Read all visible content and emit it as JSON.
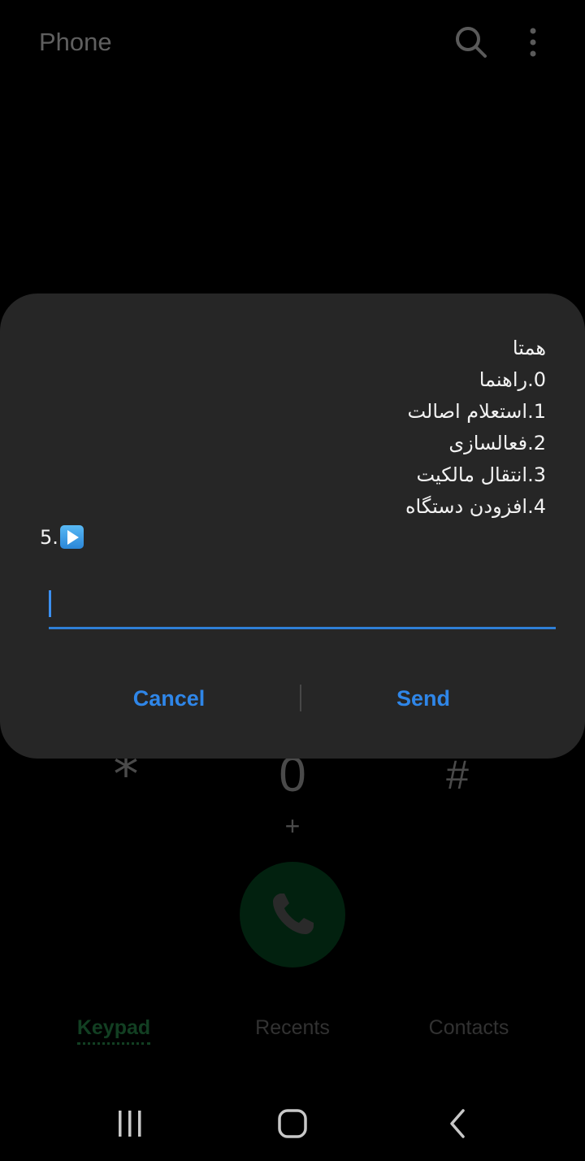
{
  "app": {
    "title": "Phone"
  },
  "keypad": {
    "star": "*",
    "zero": "0",
    "hash": "#",
    "plus": "+"
  },
  "tabs": [
    {
      "label": "Keypad",
      "active": true
    },
    {
      "label": "Recents",
      "active": false
    },
    {
      "label": "Contacts",
      "active": false
    }
  ],
  "dialog": {
    "lines": [
      "همتا",
      "0.راهنما",
      "1.استعلام اصالت",
      "2.فعالسازی",
      "3.انتقال مالکیت",
      "4.افزودن دستگاه"
    ],
    "last_line": "5.",
    "input_value": "",
    "cancel_label": "Cancel",
    "send_label": "Send"
  },
  "colors": {
    "dialog_bg": "#262626",
    "accent": "#2f86e8",
    "call_button": "#02210f"
  }
}
